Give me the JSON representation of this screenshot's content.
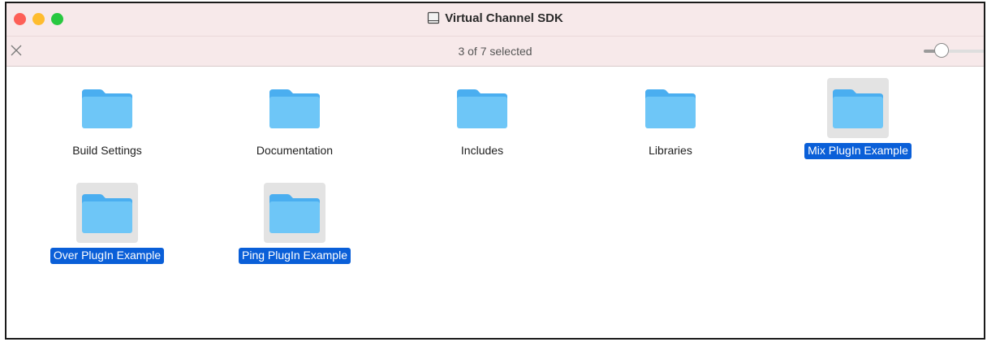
{
  "window": {
    "title": "Virtual Channel SDK",
    "status": "3 of 7 selected"
  },
  "colors": {
    "close": "#fd5f57",
    "minimize": "#febc2e",
    "zoom": "#28c840",
    "selection": "#0a5fd8",
    "folder": "#6ec6f7",
    "folder_tab": "#4aaef0"
  },
  "icons": {
    "close_toolbar": "close-icon",
    "title": "disk-icon",
    "folder": "folder-icon"
  },
  "items": [
    {
      "label": "Build Settings",
      "selected": false
    },
    {
      "label": "Documentation",
      "selected": false
    },
    {
      "label": "Includes",
      "selected": false
    },
    {
      "label": "Libraries",
      "selected": false
    },
    {
      "label": "Mix PlugIn Example",
      "selected": true
    },
    {
      "label": "Over PlugIn Example",
      "selected": true
    },
    {
      "label": "Ping PlugIn Example",
      "selected": true
    }
  ]
}
